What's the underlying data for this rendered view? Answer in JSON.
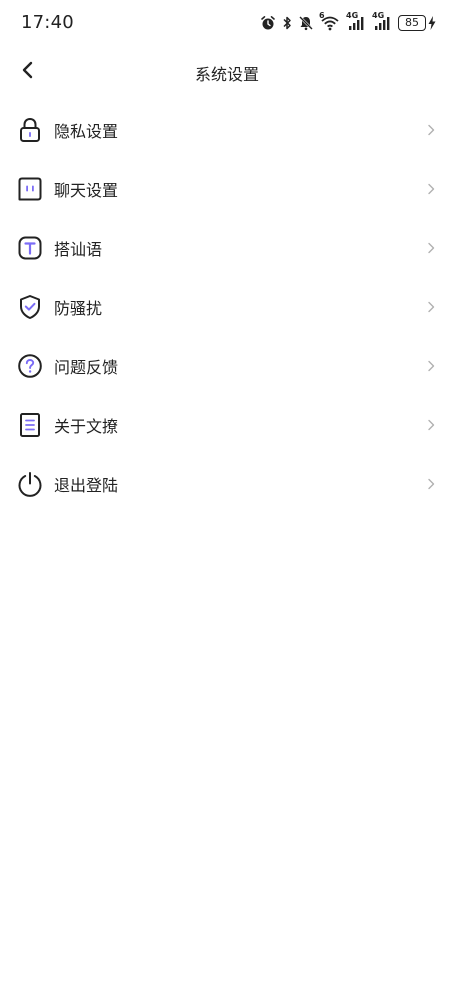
{
  "status_bar": {
    "time": "17:40",
    "battery_level": "85",
    "signal1_label": "4G",
    "signal2_label": "4G",
    "wifi_label": "6",
    "icons": [
      "alarm-icon",
      "bluetooth-icon",
      "mute-bell-icon",
      "wifi-icon",
      "signal-icon",
      "signal-icon",
      "battery-icon",
      "charging-icon"
    ]
  },
  "header": {
    "title": "系统设置",
    "back_icon": "chevron-left-icon"
  },
  "settings": {
    "items": [
      {
        "label": "隐私设置",
        "icon": "lock-icon"
      },
      {
        "label": "聊天设置",
        "icon": "chat-icon"
      },
      {
        "label": "搭讪语",
        "icon": "text-t-icon"
      },
      {
        "label": "防骚扰",
        "icon": "shield-check-icon"
      },
      {
        "label": "问题反馈",
        "icon": "question-icon"
      },
      {
        "label": "关于文撩",
        "icon": "document-icon"
      },
      {
        "label": "退出登陆",
        "icon": "power-icon"
      }
    ]
  },
  "colors": {
    "accent": "#7b6cf6",
    "text": "#222222",
    "chevron": "#b0b0b0",
    "background": "#ffffff"
  }
}
